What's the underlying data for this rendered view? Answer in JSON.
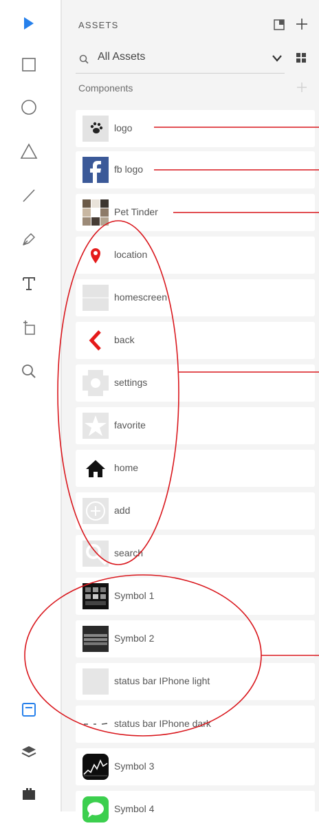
{
  "toolbar": {
    "tools": [
      {
        "icon": "select-arrow-icon"
      },
      {
        "icon": "rectangle-icon"
      },
      {
        "icon": "ellipse-icon"
      },
      {
        "icon": "triangle-icon"
      },
      {
        "icon": "line-icon"
      },
      {
        "icon": "pen-icon"
      },
      {
        "icon": "text-icon"
      },
      {
        "icon": "artboard-icon"
      },
      {
        "icon": "zoom-icon"
      }
    ],
    "bottom": [
      {
        "icon": "assets-panel-icon"
      },
      {
        "icon": "layers-icon"
      },
      {
        "icon": "plugins-icon"
      }
    ],
    "accent_color": "#2680eb"
  },
  "panel": {
    "title": "ASSETS",
    "search": {
      "value": "All Assets"
    },
    "section_label": "Components",
    "items": [
      {
        "label": "logo",
        "thumb": "logo-paw-thumbnail"
      },
      {
        "label": "fb logo",
        "thumb": "facebook-logo-thumbnail"
      },
      {
        "label": "Pet Tinder",
        "thumb": "pet-photo-collage-thumbnail"
      },
      {
        "label": "location",
        "thumb": "map-pin-thumbnail"
      },
      {
        "label": "homescreen",
        "thumb": "homescreen-thumbnail"
      },
      {
        "label": "back",
        "thumb": "back-chevron-thumbnail"
      },
      {
        "label": "settings",
        "thumb": "settings-gear-thumbnail"
      },
      {
        "label": "favorite",
        "thumb": "star-thumbnail"
      },
      {
        "label": "home",
        "thumb": "house-thumbnail"
      },
      {
        "label": "add",
        "thumb": "plus-circle-thumbnail"
      },
      {
        "label": "search",
        "thumb": "magnifier-thumbnail"
      },
      {
        "label": "Symbol 1",
        "thumb": "dark-grid-thumbnail"
      },
      {
        "label": "Symbol 2",
        "thumb": "keyboard-thumbnail"
      },
      {
        "label": "status bar IPhone light",
        "thumb": "status-bar-light-thumbnail"
      },
      {
        "label": "status bar IPhone dark",
        "thumb": "status-bar-dark-thumbnail"
      },
      {
        "label": "Symbol 3",
        "thumb": "stocks-app-thumbnail"
      },
      {
        "label": "Symbol 4",
        "thumb": "messages-app-thumbnail"
      }
    ]
  },
  "annotation_color": "#d9161c"
}
